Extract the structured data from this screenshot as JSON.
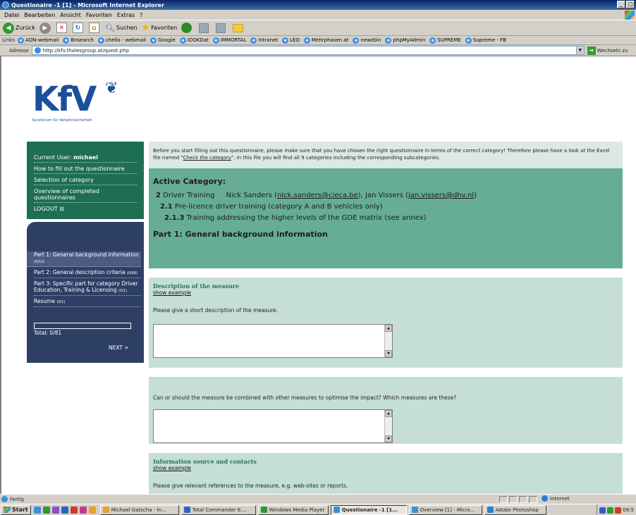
{
  "window": {
    "title": "Questionaire -1 [1] - Microsoft Internet Explorer"
  },
  "menu": [
    "Datei",
    "Bearbeiten",
    "Ansicht",
    "Favoriten",
    "Extras",
    "?"
  ],
  "toolbar": {
    "back": "Zurück",
    "search": "Suchen",
    "favorites": "Favoriten"
  },
  "links_bar": {
    "label": "Links",
    "items": [
      "AON-webmail",
      "Bnsearch",
      "chello - webmail",
      "Google",
      "IDOKDat",
      "IMMORTAL",
      "Intranet",
      "LEO",
      "Mehrphasen.at",
      "newzbin",
      "phpMyAdmin",
      "SUPREME",
      "Supreme - FB"
    ]
  },
  "address_bar": {
    "label": "Adresse",
    "url": "http://kfv.thalesgroup.at/quest.php",
    "go": "Wechseln zu"
  },
  "logo": {
    "text": "KfV",
    "subtitle": "Kuratorium für Verkehrssicherheit"
  },
  "sidebar_top": {
    "current_user_label": "Current User:",
    "current_user": "michael",
    "items": [
      "How to fill out the questionnaire",
      "Selection of category",
      "Overview of completed questionnaires"
    ],
    "logout": "LOGOUT ⊟"
  },
  "sidebar_nav": {
    "parts": [
      {
        "label": "Part 1: General background information",
        "count": "(0/12)"
      },
      {
        "label": "Part 2: General description criteria",
        "count": "(0/68)"
      },
      {
        "label": "Part 3: Specific part for category Driver Education, Training & Licensing",
        "count": "(0/1)"
      },
      {
        "label": "Resume",
        "count": "(0/1)"
      }
    ],
    "total": "Total: 0/81",
    "next": "NEXT >"
  },
  "intro": {
    "text_before": "Before you start filling out this questionnaire, please make sure that you have chosen the right questionnaire in terms of the correct category! Therefore please have a look at the Excel file named \"",
    "link": "Check the category",
    "text_after": "\". In this file you will find all 9 categories including the corresponding subcategories."
  },
  "active_category": {
    "heading": "Active Category:",
    "l1_num": "2",
    "l1_text": "Driver Training",
    "l1_contacts_a": "Nick Sanders (",
    "l1_email_1": "nick.sanders@cieca.be",
    "l1_contacts_b": "), Jan Vissers (",
    "l1_email_2": "jan.vissers@dhv.nl",
    "l1_contacts_c": ")",
    "l2_num": "2.1",
    "l2_text": "Pre-licence driver training (category A and B vehicles only)",
    "l3_num": "2.1.3",
    "l3_text": "Training addressing the higher levels of the GDE matrix (see annex)",
    "part_title": "Part 1: General background information"
  },
  "questions": [
    {
      "heading": "Description of the measure",
      "example": "show example",
      "text": "Please give a short description of the measure."
    },
    {
      "heading": "",
      "example": "",
      "text": "Can or should the measure be combined with other measures to optimise the impact? Which measures are these?"
    },
    {
      "heading": "Information source and contacts",
      "example": "show example",
      "text": "Please give relevant references to the measure, e.g. web-sites or reports."
    }
  ],
  "statusbar": {
    "status": "Fertig",
    "zone": "Internet"
  },
  "taskbar": {
    "start": "Start",
    "tasks": [
      {
        "label": "Michael Gatscha - In...",
        "active": false
      },
      {
        "label": "Total Commander 6....",
        "active": false
      },
      {
        "label": "Windows Media Player",
        "active": false
      },
      {
        "label": "Questionaire -1 [1...",
        "active": true
      },
      {
        "label": "Overview [1] - Micro...",
        "active": false
      },
      {
        "label": "Adobe Photoshop",
        "active": false
      }
    ],
    "clock": "09:5"
  },
  "colors": {
    "sidebar_green": "#1e6e52",
    "sidebar_navy": "#2e3f66",
    "active_category_bg": "#66ad94",
    "question_bg": "#c5dfd5",
    "logo_blue": "#1b4f9c"
  }
}
